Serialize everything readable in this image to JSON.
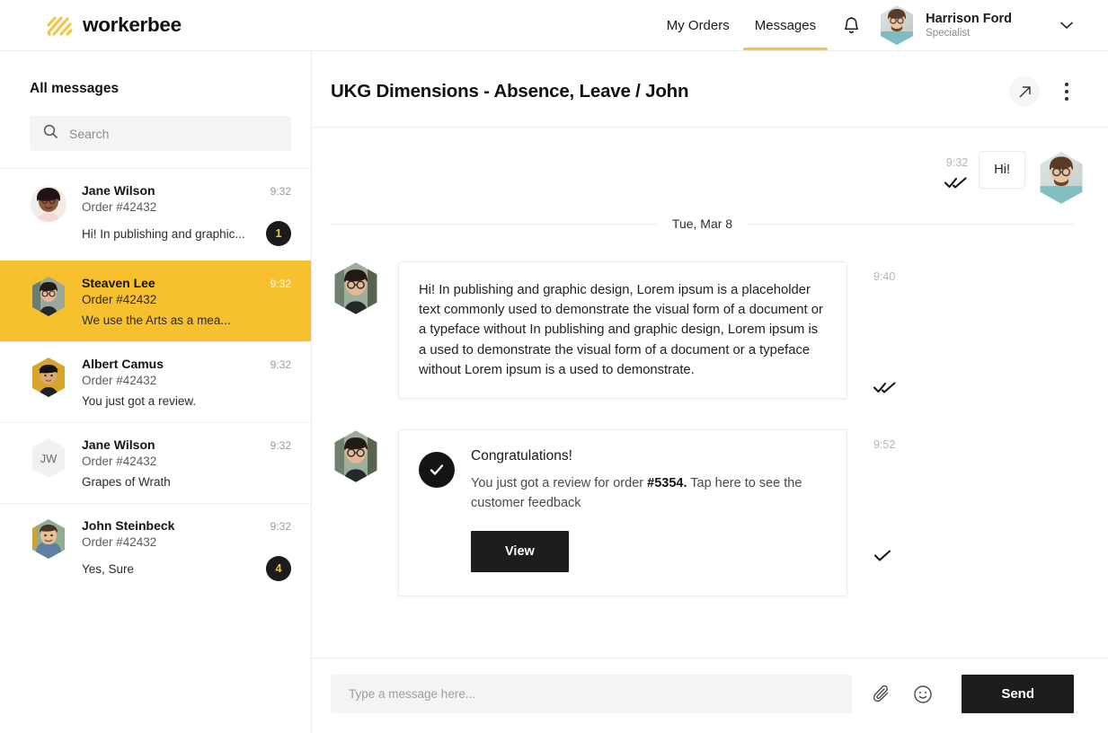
{
  "brand": {
    "name": "workerbee",
    "logo_icon": "workerbee-stripes-logo",
    "accent": "#F5C542"
  },
  "header": {
    "nav": [
      {
        "label": "My Orders",
        "active": false
      },
      {
        "label": "Messages",
        "active": true
      }
    ],
    "bell_icon": "bell-icon",
    "chevron_icon": "chevron-down-icon",
    "user": {
      "name": "Harrison Ford",
      "role": "Specialist",
      "avatar": "harrison-ford-avatar"
    }
  },
  "sidebar": {
    "title": "All messages",
    "search": {
      "placeholder": "Search",
      "value": "",
      "icon": "search-icon"
    },
    "conversations": [
      {
        "name": "Jane Wilson",
        "order": "Order #42432",
        "preview": "Hi! In publishing and graphic...",
        "time": "9:32",
        "badge": "1",
        "selected": false,
        "avatar_type": "photo"
      },
      {
        "name": "Steaven Lee",
        "order": "Order #42432",
        "preview": "We use the Arts as a mea...",
        "time": "9:32",
        "badge": "",
        "selected": true,
        "avatar_type": "photo"
      },
      {
        "name": "Albert Camus",
        "order": "Order #42432",
        "preview": "You just got a review.",
        "time": "9:32",
        "badge": "",
        "selected": false,
        "avatar_type": "photo"
      },
      {
        "name": "Jane Wilson",
        "order": "Order #42432",
        "preview": "Grapes of Wrath",
        "time": "9:32",
        "badge": "",
        "selected": false,
        "avatar_type": "initials",
        "initials": "JW"
      },
      {
        "name": "John Steinbeck",
        "order": "Order #42432",
        "preview": "Yes, Sure",
        "time": "9:32",
        "badge": "4",
        "selected": false,
        "avatar_type": "photo"
      }
    ]
  },
  "chat": {
    "title": "UKG Dimensions - Absence, Leave / John",
    "expand_icon": "arrow-up-right-icon",
    "menu_icon": "more-vertical-icon",
    "outgoing": {
      "text": "Hi!",
      "time": "9:32",
      "receipt": "double-check"
    },
    "date_separator": "Tue, Mar 8",
    "message_1": {
      "text": "Hi! In publishing and graphic design, Lorem ipsum is a placeholder text commonly used to demonstrate the visual form of a document or a typeface without In publishing and graphic design, Lorem ipsum is a  used to demonstrate the visual form of a document or a typeface without Lorem ipsum is a  used to demonstrate.",
      "time": "9:40",
      "receipt": "double-check"
    },
    "message_2": {
      "title": "Congratulations!",
      "text_before": "You just got a review for order ",
      "order_ref": "#5354.",
      "text_after": " Tap here to see the customer feedback",
      "button_label": "View",
      "time": "9:52",
      "receipt": "single-check",
      "status_icon": "check-circle-icon"
    }
  },
  "composer": {
    "placeholder": "Type a message here...",
    "value": "",
    "attach_icon": "paperclip-icon",
    "emoji_icon": "smiley-icon",
    "send_label": "Send"
  }
}
